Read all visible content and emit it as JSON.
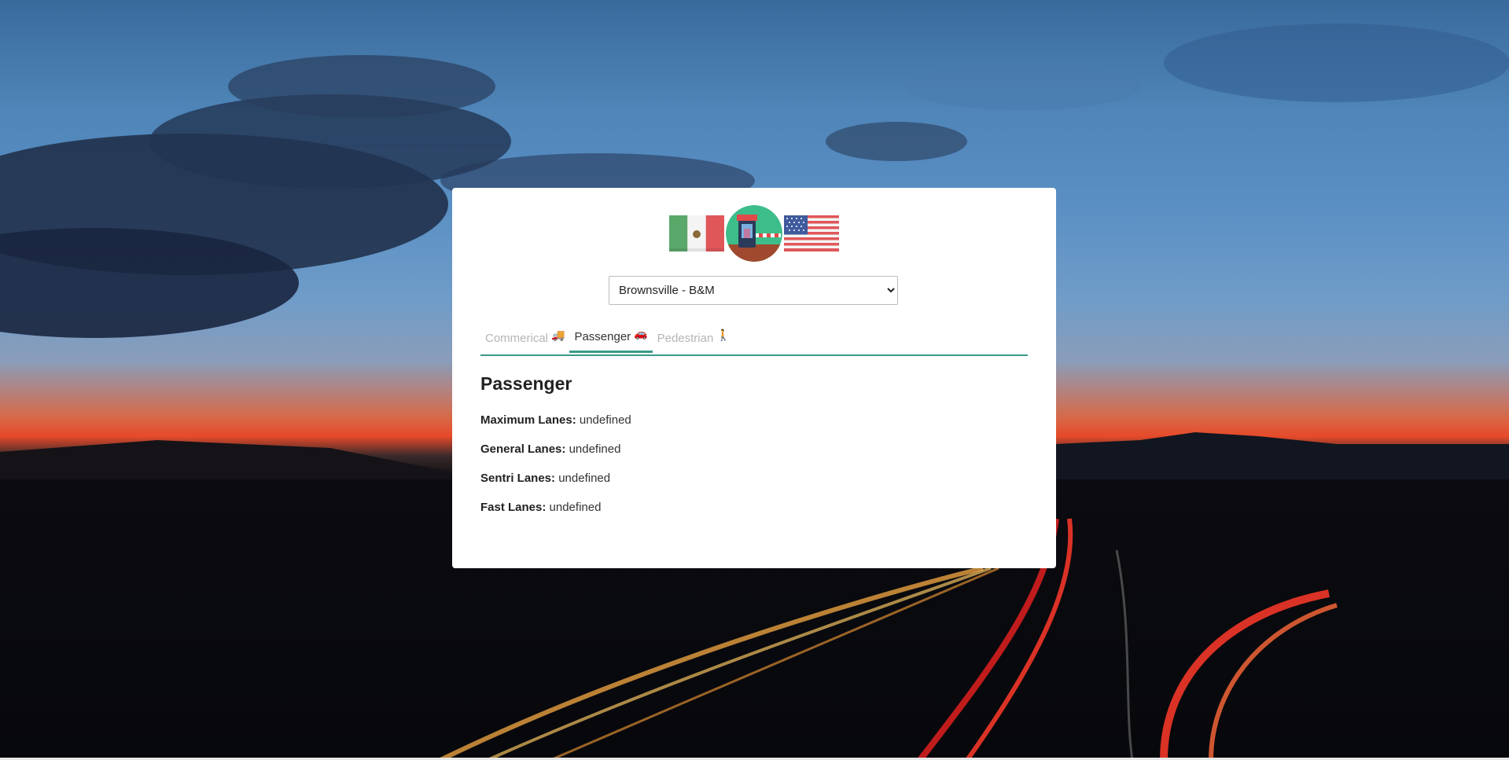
{
  "crossing_select": {
    "selected": "Brownsville - B&M"
  },
  "tabs": [
    {
      "label": "Commerical",
      "emoji": "🚚",
      "active": false
    },
    {
      "label": "Passenger",
      "emoji": "🚗",
      "active": true
    },
    {
      "label": "Pedestrian",
      "emoji": "🚶",
      "active": false
    }
  ],
  "section": {
    "title": "Passenger",
    "rows": [
      {
        "label": "Maximum Lanes:",
        "value": "undefined"
      },
      {
        "label": "General Lanes:",
        "value": "undefined"
      },
      {
        "label": "Sentri Lanes:",
        "value": "undefined"
      },
      {
        "label": "Fast Lanes:",
        "value": "undefined"
      }
    ]
  },
  "colors": {
    "accent": "#3a9a8a"
  },
  "icons": {
    "left_flag": "mexico-flag-icon",
    "center": "border-booth-icon",
    "right_flag": "usa-flag-icon"
  }
}
